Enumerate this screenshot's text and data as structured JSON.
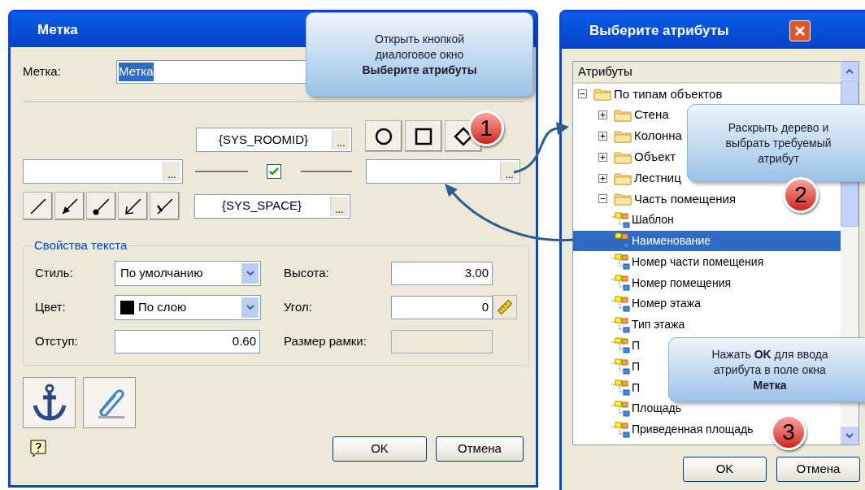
{
  "label_dialog": {
    "title": "Метка",
    "label_field": {
      "label": "Метка:",
      "value": "Метка"
    },
    "fields": {
      "top": {
        "value": "{SYS_ROOMID}",
        "browse": "..."
      },
      "left": {
        "browse": "..."
      },
      "right": {
        "browse": "..."
      },
      "bottom": {
        "value": "{SYS_SPACE}",
        "browse": "..."
      }
    },
    "leader_checkbox": {
      "checked": true
    },
    "text_properties": {
      "title": "Свойства текста",
      "style": {
        "label": "Стиль:",
        "value": "По умолчанию"
      },
      "color": {
        "label": "Цвет:",
        "value": "По слою"
      },
      "offset": {
        "label": "Отступ:",
        "value": "0.60"
      },
      "height": {
        "label": "Высота:",
        "value": "3.00"
      },
      "angle": {
        "label": "Угол:",
        "value": "0"
      },
      "frame_size": {
        "label": "Размер рамки:",
        "disabled": true
      }
    },
    "buttons": [
      "OK",
      "Отмена"
    ]
  },
  "attributes_dialog": {
    "title": "Выберите атрибуты",
    "tree_header": "Атрибуты",
    "tree": [
      {
        "kind": "folder",
        "label": "По типам объектов",
        "expanded": true,
        "children": [
          {
            "kind": "folder",
            "label": "Стена",
            "expanded": false
          },
          {
            "kind": "folder",
            "label": "Колонна",
            "expanded": false
          },
          {
            "kind": "folder",
            "label": "Объект",
            "expanded": false
          },
          {
            "kind": "folder",
            "label": "Лестниц",
            "expanded": false
          },
          {
            "kind": "folder",
            "label": "Часть помещения",
            "expanded": true,
            "children": [
              {
                "kind": "attribute",
                "label": "Шаблон",
                "selected": false
              },
              {
                "kind": "attribute",
                "label": "Наименование",
                "selected": true
              },
              {
                "kind": "attribute",
                "label": "Номер части помещения",
                "selected": false
              },
              {
                "kind": "attribute",
                "label": "Номер помещения",
                "selected": false
              },
              {
                "kind": "attribute",
                "label": "Номер этажа",
                "selected": false
              },
              {
                "kind": "attribute",
                "label": "Тип этажа",
                "selected": false
              },
              {
                "kind": "attribute",
                "label": "П",
                "selected": false
              },
              {
                "kind": "attribute",
                "label": "П",
                "selected": false
              },
              {
                "kind": "attribute",
                "label": "П",
                "selected": false
              },
              {
                "kind": "attribute",
                "label": "Площадь",
                "selected": false
              },
              {
                "kind": "attribute",
                "label": "Приведенная площадь",
                "selected": false
              }
            ]
          }
        ]
      }
    ],
    "buttons": [
      "OK",
      "Отмена"
    ]
  },
  "callouts": [
    {
      "number": "1",
      "lines": [
        "Открыть кнопкой",
        "диалоговое окно",
        "**Выберите атрибуты**"
      ]
    },
    {
      "number": "2",
      "lines": [
        "Раскрыть дерево и",
        "выбрать требуемый",
        "атрибут"
      ]
    },
    {
      "number": "3",
      "lines": [
        "Нажать **OK** для ввода",
        "атрибута в поле окна",
        "**Метка**"
      ]
    }
  ]
}
